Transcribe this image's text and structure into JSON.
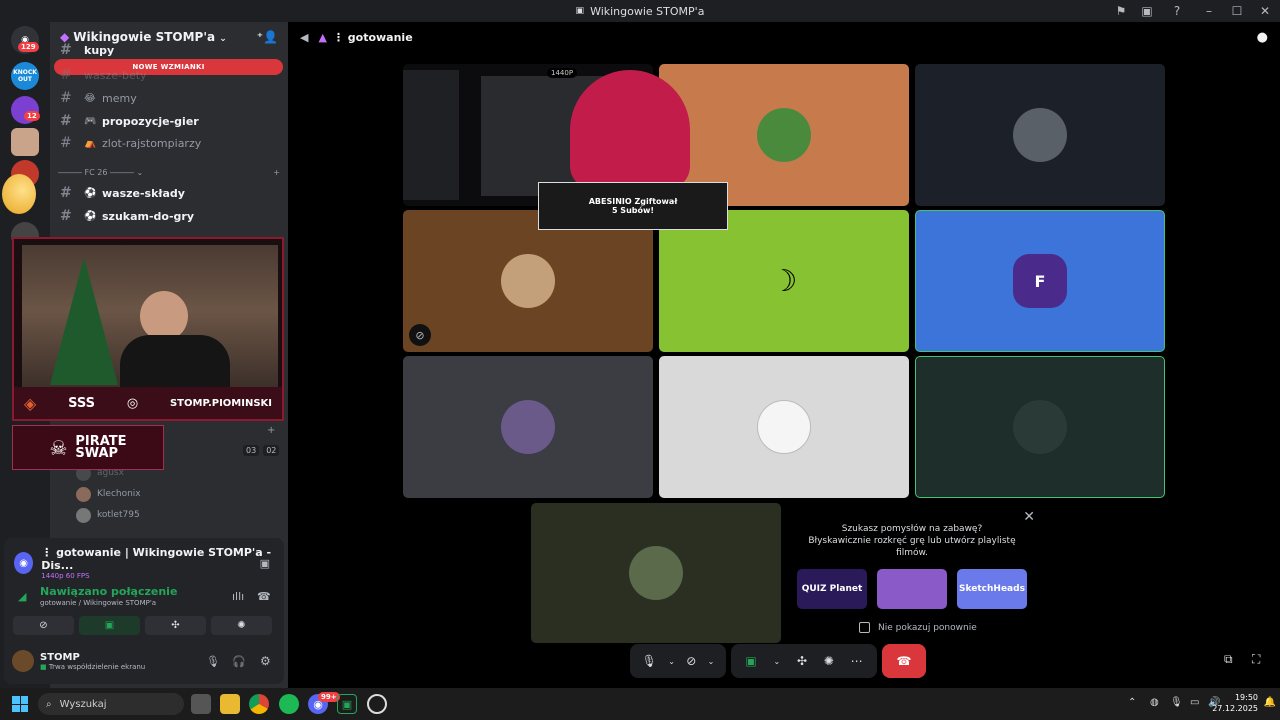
{
  "window": {
    "title": "Wikingowie STOMP'a"
  },
  "servers": {
    "home_badge": "129",
    "items": [
      {
        "label": "KNOCK OUT",
        "color": "#1a8ad8"
      },
      {
        "label": "",
        "color": "#7b3fd1",
        "badge": "12"
      },
      {
        "label": "",
        "color": "#c9a38a"
      },
      {
        "label": "",
        "color": "#c0392b"
      },
      {
        "label": "",
        "color": "#444"
      }
    ]
  },
  "sidebar": {
    "server_name": "Wikingowie STOMP'a",
    "new_mentions": "NOWE WZMIANKI",
    "channels": [
      {
        "name": "kupy",
        "emoji": "",
        "bold": true
      },
      {
        "name": "wasze-bety",
        "emoji": "",
        "bold": false
      },
      {
        "name": "memy",
        "emoji": "😂",
        "bold": false
      },
      {
        "name": "propozycje-gier",
        "emoji": "🎮",
        "bold": true
      },
      {
        "name": "zlot-rajstompiarzy",
        "emoji": "⛺",
        "bold": false
      }
    ],
    "category": "FC 26",
    "fc_channels": [
      {
        "name": "wasze-składy",
        "emoji": "⚽",
        "bold": true
      },
      {
        "name": "szukam-do-gry",
        "emoji": "⚽",
        "bold": true
      }
    ],
    "voice_users": [
      {
        "name": "agusx"
      },
      {
        "name": "Klechonix"
      },
      {
        "name": "kotlet795"
      }
    ],
    "voice_counter": [
      "03",
      "02"
    ]
  },
  "webcam": {
    "handle": "STOMP.PIOMINSKI",
    "pirate_line1": "PIRATE",
    "pirate_line2": "SWAP"
  },
  "stream_panel": {
    "title": "⋮ gotowanie | Wikingowie STOMP'a - Dis...",
    "quality": "1440p 60 FPS",
    "connection": "Nawiązano połączenie",
    "connection_sub": "gotowanie / Wikingowie STOMP'a",
    "username": "STOMP",
    "status": "Trwa współdzielenie ekranu"
  },
  "main": {
    "channel": "⋮ gotowanie",
    "stream_label": "1440P",
    "alert_line1": "ABESINIO Zgiftował",
    "alert_line2": "5 Subów!"
  },
  "promo": {
    "text_line1": "Szukasz pomysłów na zabawę?",
    "text_line2": "Błyskawicznie rozkręć grę lub utwórz playlistę",
    "text_line3": "filmów.",
    "games": [
      "QUIZ Planet",
      "",
      "SketchHeads"
    ],
    "dont_show": "Nie pokazuj ponownie"
  },
  "taskbar": {
    "search_placeholder": "Wyszukaj",
    "time": "19:50",
    "date": "27.12.2025",
    "discord_badge": "99+"
  },
  "colors": {
    "tile_orange": "#c77a4c",
    "tile_brown": "#6b4523",
    "tile_green": "#86c232",
    "tile_blue": "#3d74d9",
    "tile_gray": "#3b3d42",
    "tile_light": "#d9d9d9",
    "tile_dark": "#1d2e2b",
    "tile_navy": "#1c2028",
    "hangup": "#da373c"
  }
}
